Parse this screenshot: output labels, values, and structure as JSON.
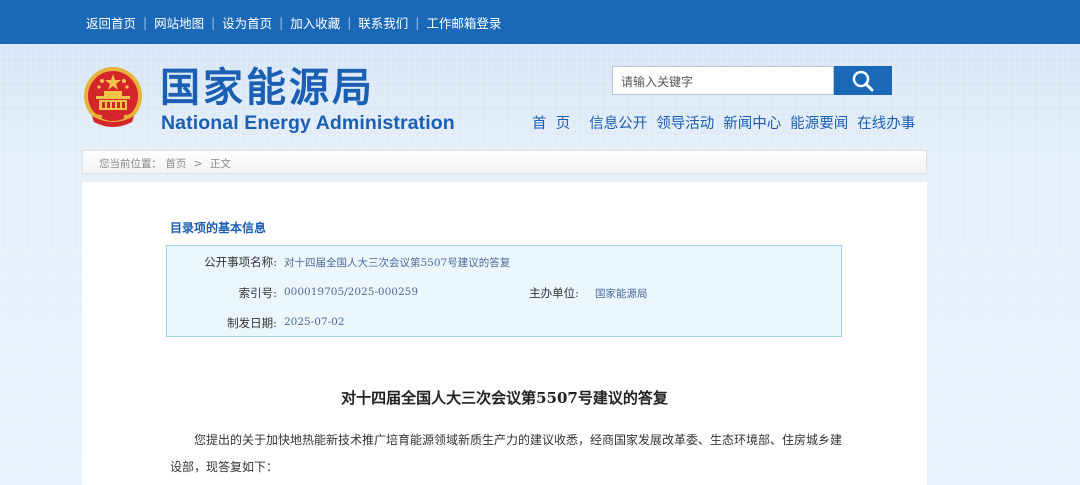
{
  "topbar": {
    "links": [
      "返回首页",
      "网站地图",
      "设为首页",
      "加入收藏",
      "联系我们",
      "工作邮箱登录"
    ]
  },
  "logo": {
    "cn": "国家能源局",
    "en": "National Energy Administration"
  },
  "search": {
    "placeholder": "请输入关键字"
  },
  "nav": {
    "items": [
      "首  页",
      "信息公开",
      "领导活动",
      "新闻中心",
      "能源要闻",
      "在线办事"
    ]
  },
  "breadcrumb": {
    "prefix": "您当前位置：",
    "home": "首页",
    "separator": ">",
    "current": "正文"
  },
  "meta": {
    "heading": "目录项的基本信息",
    "name_label": "公开事项名称:",
    "name_value": "对十四届全国人大三次会议第5507号建议的答复",
    "index_label": "索引号:",
    "index_value": "000019705/2025-000259",
    "org_label": "主办单位:",
    "org_value": "国家能源局",
    "date_label": "制发日期:",
    "date_value": "2025-07-02"
  },
  "document": {
    "title": "对十四届全国人大三次会议第5507号建议的答复",
    "body": "您提出的关于加快地热能新技术推广培育能源领域新质生产力的建议收悉，经商国家发展改革委、生态环境部、住房城乡建设部，现答复如下："
  },
  "colors": {
    "brand_blue": "#1a69b8",
    "meta_box_bg": "#ebf6fd"
  },
  "icons": [
    "national-emblem-icon",
    "search-icon"
  ]
}
